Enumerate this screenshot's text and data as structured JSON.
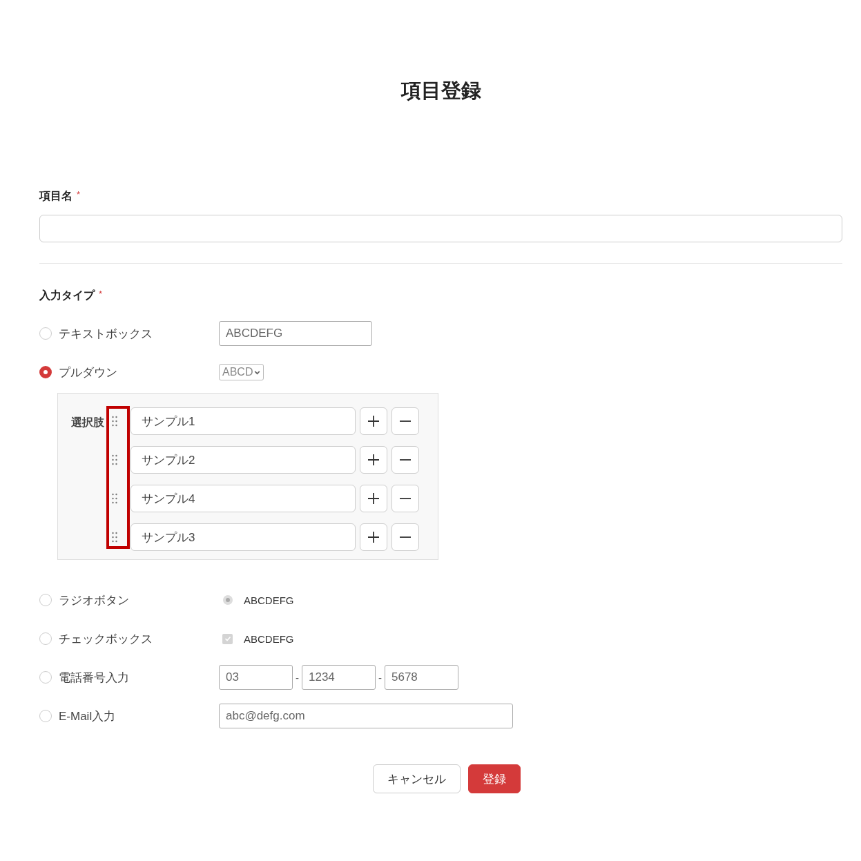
{
  "title": "項目登録",
  "item_name": {
    "label": "項目名",
    "required_mark": "*"
  },
  "input_type": {
    "label": "入力タイプ",
    "required_mark": "*",
    "options": [
      {
        "kind": "textbox",
        "label": "テキストボックス",
        "selected": false,
        "sample": "ABCDEFG"
      },
      {
        "kind": "dropdown",
        "label": "プルダウン",
        "selected": true,
        "sample": "ABCD",
        "choices_label": "選択肢",
        "handles_highlighted": true,
        "choices": [
          "サンプル1",
          "サンプル2",
          "サンプル4",
          "サンプル3"
        ]
      },
      {
        "kind": "radio",
        "label": "ラジオボタン",
        "selected": false,
        "sample": {
          "label": "ABCDEFG",
          "checked": true
        }
      },
      {
        "kind": "checkbox",
        "label": "チェックボックス",
        "selected": false,
        "sample": {
          "label": "ABCDEFG",
          "checked": true
        }
      },
      {
        "kind": "phone",
        "label": "電話番号入力",
        "selected": false,
        "parts": [
          "03",
          "1234",
          "5678"
        ],
        "separators": [
          "-",
          "-"
        ]
      },
      {
        "kind": "email",
        "label": "E-Mail入力",
        "selected": false,
        "sample": "abc@defg.com"
      }
    ]
  },
  "buttons": [
    {
      "kind": "cancel",
      "label": "キャンセル"
    },
    {
      "kind": "submit",
      "label": "登録"
    }
  ]
}
